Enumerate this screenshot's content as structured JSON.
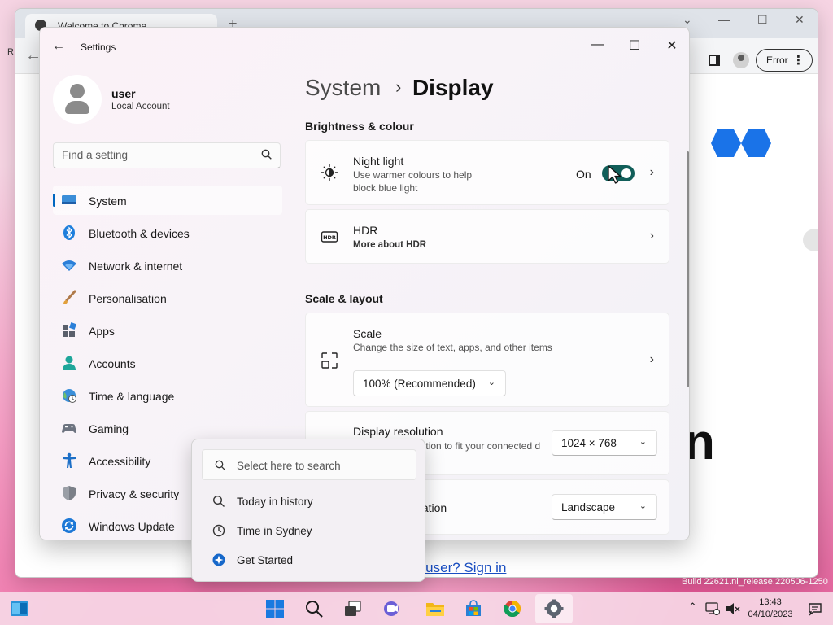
{
  "background_browser": {
    "tab_title": "Welcome to Chrome",
    "error_label": "Error",
    "page_link": "e user? Sign in",
    "big_glyph": "n",
    "left_edge_letter": "R"
  },
  "settings": {
    "window_title": "Settings",
    "controls": {
      "minimize": "—",
      "maximize": "☐",
      "close": "✕"
    },
    "profile": {
      "name": "user",
      "account_type": "Local Account"
    },
    "search": {
      "placeholder": "Find a setting"
    },
    "nav": [
      {
        "label": "System",
        "icon": "system-icon",
        "selected": true
      },
      {
        "label": "Bluetooth & devices",
        "icon": "bluetooth-icon"
      },
      {
        "label": "Network & internet",
        "icon": "network-icon"
      },
      {
        "label": "Personalisation",
        "icon": "brush-icon"
      },
      {
        "label": "Apps",
        "icon": "apps-icon"
      },
      {
        "label": "Accounts",
        "icon": "accounts-icon"
      },
      {
        "label": "Time & language",
        "icon": "time-language-icon"
      },
      {
        "label": "Gaming",
        "icon": "gaming-icon"
      },
      {
        "label": "Accessibility",
        "icon": "accessibility-icon"
      },
      {
        "label": "Privacy & security",
        "icon": "shield-icon"
      },
      {
        "label": "Windows Update",
        "icon": "update-icon"
      }
    ],
    "breadcrumb": {
      "parent": "System",
      "separator": "›",
      "current": "Display"
    },
    "sections": {
      "brightness": {
        "heading": "Brightness & colour",
        "night_light": {
          "title": "Night light",
          "desc": "Use warmer colours to help block blue light",
          "state_label": "On",
          "toggle_on": true
        },
        "hdr": {
          "title": "HDR",
          "link": "More about HDR"
        }
      },
      "scale_layout": {
        "heading": "Scale & layout",
        "scale": {
          "title": "Scale",
          "desc": "Change the size of text, apps, and other items",
          "value": "100% (Recommended)"
        },
        "resolution": {
          "title": "Display resolution",
          "desc": "Adjust the resolution to fit your connected display",
          "value": "1024 × 768"
        },
        "orientation": {
          "title": "Display orientation",
          "value": "Landscape"
        }
      }
    }
  },
  "flyout": {
    "search_placeholder": "Select here to search",
    "items": [
      {
        "label": "Today in history",
        "icon": "search-icon"
      },
      {
        "label": "Time in Sydney",
        "icon": "clock-icon"
      },
      {
        "label": "Get Started",
        "icon": "get-started-icon"
      }
    ]
  },
  "taskbar": {
    "apps": [
      "start-icon",
      "search-icon",
      "task-view-icon",
      "meet-icon",
      "file-explorer-icon",
      "store-icon",
      "chrome-icon",
      "settings-icon"
    ],
    "clock": {
      "time": "13:43",
      "date": "04/10/2023"
    },
    "build": "Build 22621.ni_release.220506-1250"
  },
  "colors": {
    "accent": "#0067c0",
    "toggle_on": "#115e59",
    "link": "#1a4fc4"
  }
}
